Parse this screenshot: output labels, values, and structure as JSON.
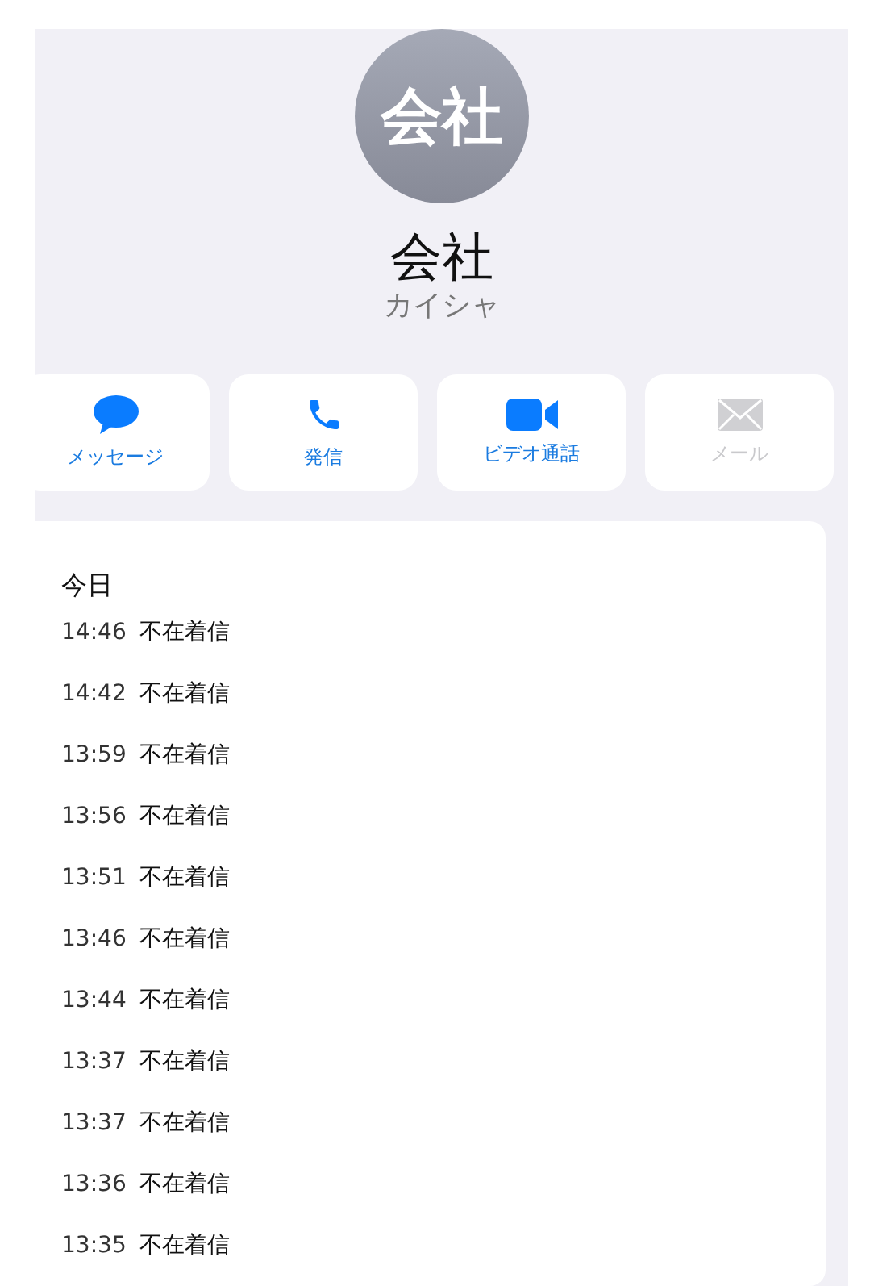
{
  "contact": {
    "initials": "会社",
    "name": "会社",
    "reading": "カイシャ"
  },
  "actions": [
    {
      "kind": "message",
      "label": "メッセージ",
      "disabled": false
    },
    {
      "kind": "call",
      "label": "発信",
      "disabled": false
    },
    {
      "kind": "video",
      "label": "ビデオ通話",
      "disabled": false
    },
    {
      "kind": "mail",
      "label": "メール",
      "disabled": true
    }
  ],
  "history": {
    "heading": "今日",
    "entries": [
      {
        "time": "14:46",
        "type": "不在着信"
      },
      {
        "time": "14:42",
        "type": "不在着信"
      },
      {
        "time": "13:59",
        "type": "不在着信"
      },
      {
        "time": "13:56",
        "type": "不在着信"
      },
      {
        "time": "13:51",
        "type": "不在着信"
      },
      {
        "time": "13:46",
        "type": "不在着信"
      },
      {
        "time": "13:44",
        "type": "不在着信"
      },
      {
        "time": "13:37",
        "type": "不在着信"
      },
      {
        "time": "13:37",
        "type": "不在着信"
      },
      {
        "time": "13:36",
        "type": "不在着信"
      },
      {
        "time": "13:35",
        "type": "不在着信"
      }
    ]
  }
}
